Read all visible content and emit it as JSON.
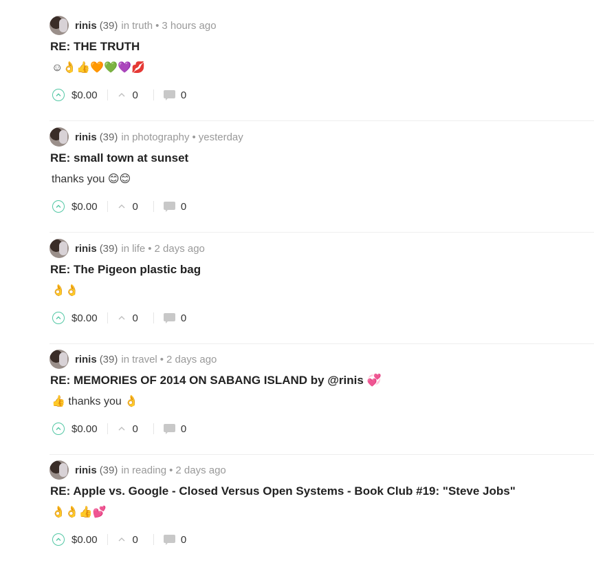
{
  "posts": [
    {
      "author": "rinis",
      "reputation": "(39)",
      "preposition": "in",
      "category": "truth",
      "bullet": "•",
      "time": "3 hours ago",
      "title": "RE: THE TRUTH",
      "body": "☺👌👍🧡💚💜💋",
      "payout": "$0.00",
      "votes": "0",
      "comments": "0"
    },
    {
      "author": "rinis",
      "reputation": "(39)",
      "preposition": "in",
      "category": "photography",
      "bullet": "•",
      "time": "yesterday",
      "title": "RE: small town at sunset",
      "body": "thanks you 😊😊",
      "payout": "$0.00",
      "votes": "0",
      "comments": "0"
    },
    {
      "author": "rinis",
      "reputation": "(39)",
      "preposition": "in",
      "category": "life",
      "bullet": "•",
      "time": "2 days ago",
      "title": "RE: The Pigeon plastic bag",
      "body": "👌👌",
      "payout": "$0.00",
      "votes": "0",
      "comments": "0"
    },
    {
      "author": "rinis",
      "reputation": "(39)",
      "preposition": "in",
      "category": "travel",
      "bullet": "•",
      "time": "2 days ago",
      "title": "RE: MEMORIES OF 2014 ON SABANG ISLAND by @rinis 💞",
      "body": "👍 thanks you 👌",
      "payout": "$0.00",
      "votes": "0",
      "comments": "0"
    },
    {
      "author": "rinis",
      "reputation": "(39)",
      "preposition": "in",
      "category": "reading",
      "bullet": "•",
      "time": "2 days ago",
      "title": "RE: Apple vs. Google - Closed Versus Open Systems - Book Club #19: \"Steve Jobs\"",
      "body": "👌👌👍💕",
      "payout": "$0.00",
      "votes": "0",
      "comments": "0"
    }
  ],
  "icons": {
    "avatar": "avatar",
    "upvote": "upvote-circle-icon",
    "votes": "chevron-up-icon",
    "comments": "comment-bubble-icon"
  },
  "colors": {
    "accent": "#52c7a4",
    "muted": "#999999",
    "divider": "#eeeeee"
  }
}
